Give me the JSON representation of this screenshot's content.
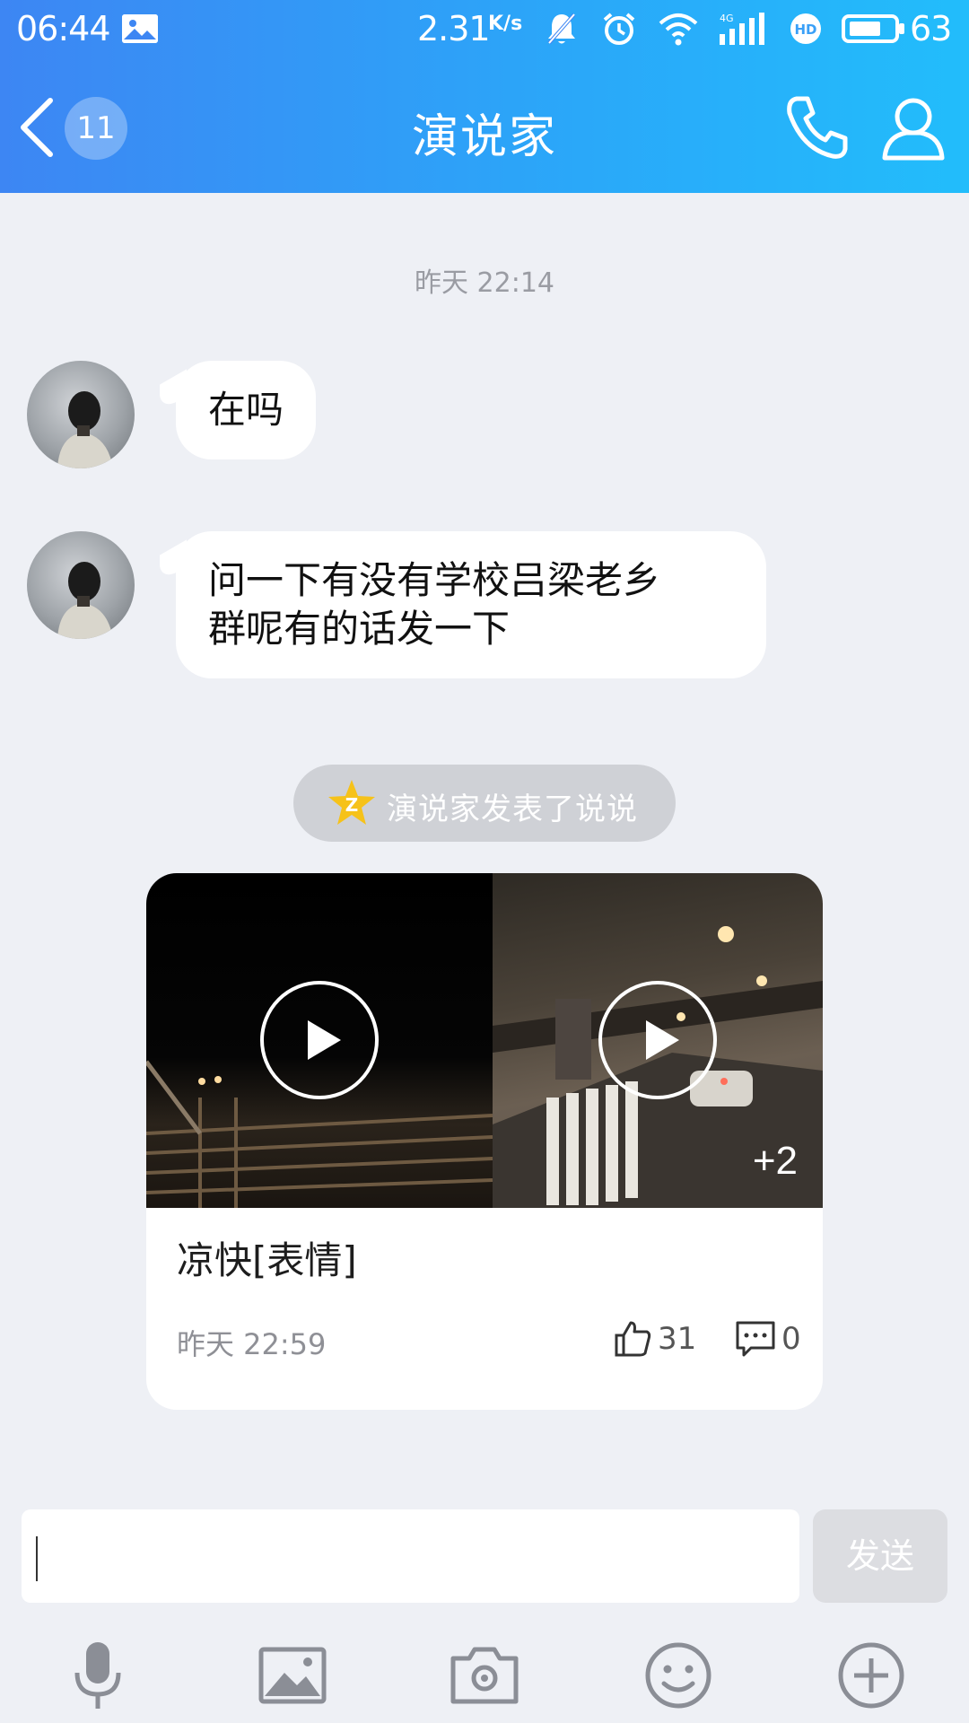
{
  "status_bar": {
    "time": "06:44",
    "net_speed": "2.31",
    "net_speed_unit": "K/s",
    "network_type": "4G",
    "hd_label": "HD",
    "battery": "63"
  },
  "nav": {
    "back_badge": "11",
    "title": "演说家"
  },
  "chat": {
    "timestamp": "昨天  22:14",
    "messages": [
      {
        "text": "在吗"
      },
      {
        "text_line1": "问一下有没有学校吕梁老乡",
        "text_line2": "群呢有的话发一下"
      }
    ],
    "qzone_notice": "演说家发表了说说"
  },
  "feed_card": {
    "caption": "凉快[表情]",
    "time": "昨天  22:59",
    "more_count": "+2",
    "likes": "31",
    "comments": "0"
  },
  "input": {
    "placeholder": "",
    "send_label": "发送"
  },
  "toolbar": {
    "icons": [
      "microphone-icon",
      "image-icon",
      "camera-icon",
      "emoji-icon",
      "plus-icon"
    ]
  },
  "colors": {
    "header_start": "#3d86f3",
    "header_end": "#22bdfb",
    "background": "#eef0f5",
    "bubble": "#ffffff"
  }
}
